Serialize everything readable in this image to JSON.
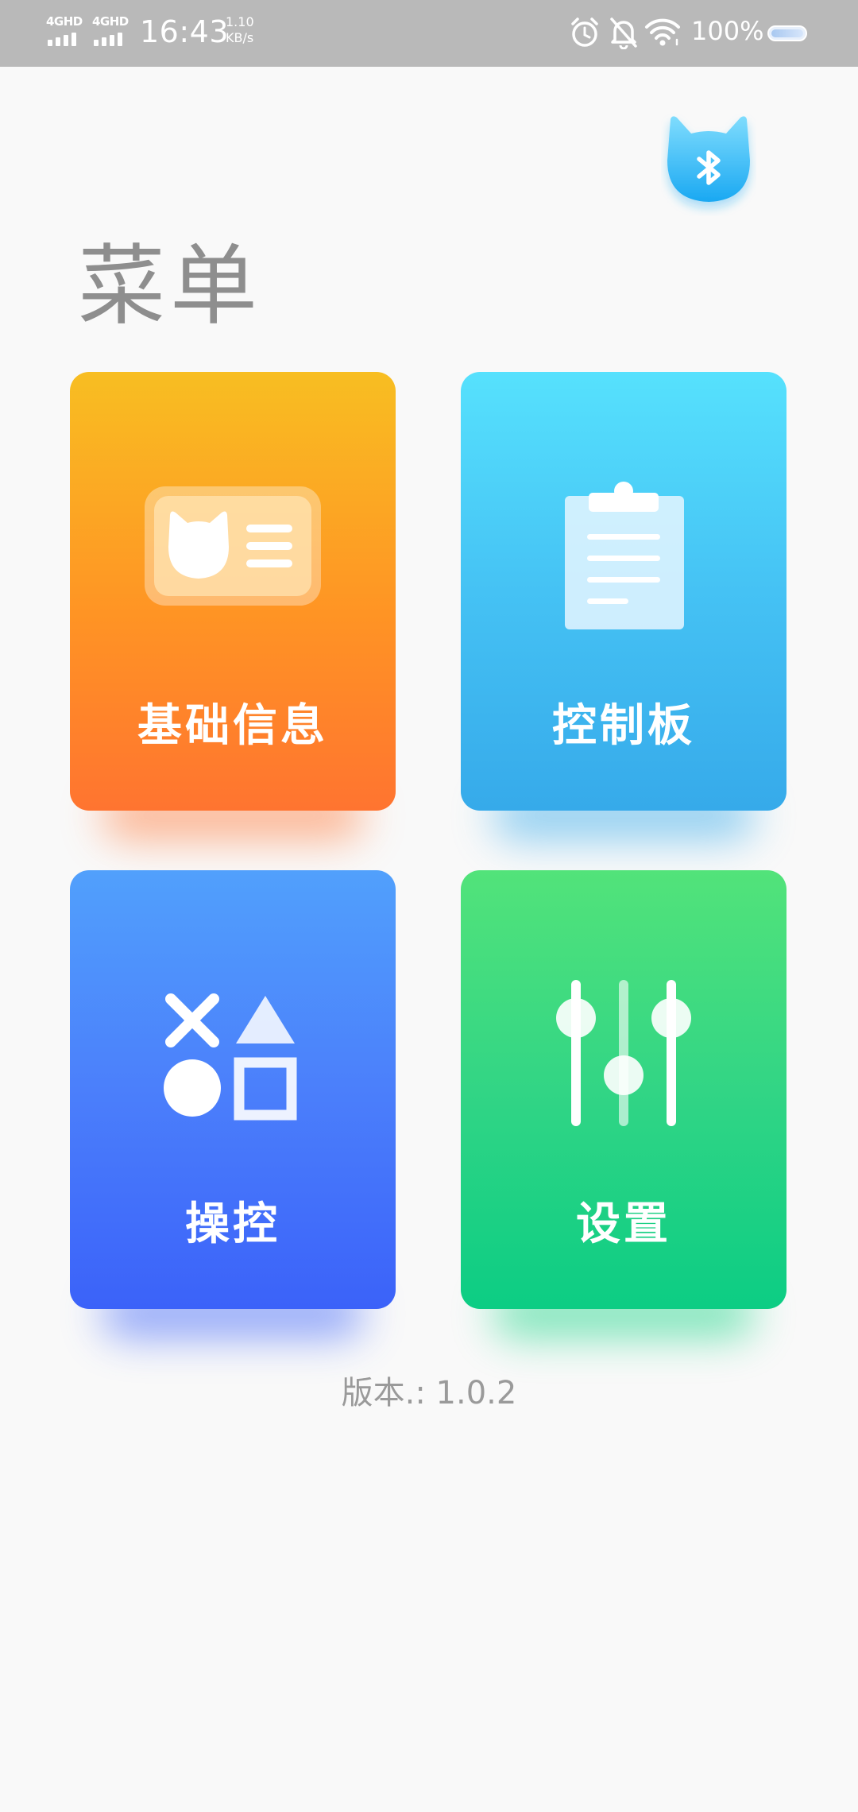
{
  "status_bar": {
    "network_1": "4GHD",
    "network_2": "4GHD",
    "time": "16:43",
    "speed_value": "1.10",
    "speed_unit": "KB/s",
    "battery_text": "100%",
    "icons": [
      "alarm-icon",
      "bell-muted-icon",
      "wifi-icon",
      "battery-icon"
    ]
  },
  "header": {
    "bluetooth_icon": "bluetooth-cat-icon",
    "title": "菜单"
  },
  "cards": [
    {
      "label": "基础信息",
      "icon": "id-card-icon",
      "color_top": "#f8be22",
      "color_bottom": "#ff7430"
    },
    {
      "label": "控制板",
      "icon": "clipboard-icon",
      "color_top": "#56e1fd",
      "color_bottom": "#36aaea"
    },
    {
      "label": "操控",
      "icon": "gamepad-shapes-icon",
      "color_top": "#51a0fc",
      "color_bottom": "#3b62f9"
    },
    {
      "label": "设置",
      "icon": "sliders-icon",
      "color_top": "#52e37a",
      "color_bottom": "#0ccd84"
    }
  ],
  "footer": {
    "version": "版本.: 1.0.2"
  }
}
